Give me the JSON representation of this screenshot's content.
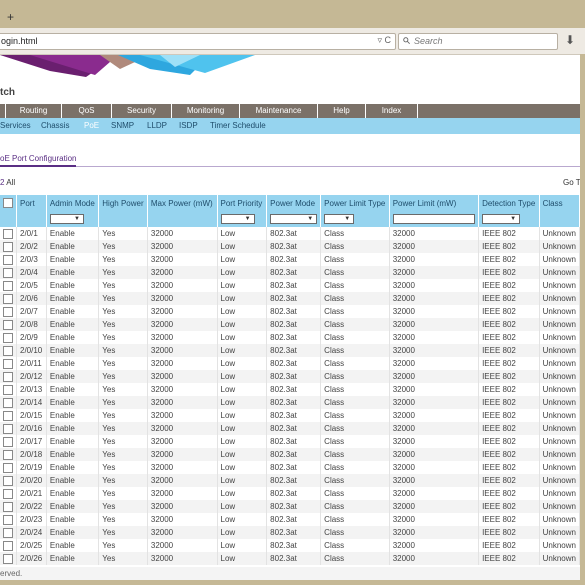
{
  "browser": {
    "newtab_symbol": "+",
    "url": "ogin.html",
    "url_icons": "▿ C",
    "search_placeholder": "Search",
    "download_symbol": "⬇"
  },
  "brand": {
    "title": "tch"
  },
  "menu": [
    {
      "label": ""
    },
    {
      "label": "Routing"
    },
    {
      "label": "QoS"
    },
    {
      "label": "Security"
    },
    {
      "label": "Monitoring"
    },
    {
      "label": "Maintenance"
    },
    {
      "label": "Help"
    },
    {
      "label": "Index"
    }
  ],
  "submenu": [
    {
      "label": "Services"
    },
    {
      "label": "Chassis"
    },
    {
      "label": "PoE",
      "active": true
    },
    {
      "label": "SNMP"
    },
    {
      "label": "LLDP"
    },
    {
      "label": "ISDP"
    },
    {
      "label": "Timer Schedule"
    }
  ],
  "page": {
    "title": "oE Port Configuration",
    "count": "2",
    "count_label": "All",
    "goto": "Go To"
  },
  "table": {
    "columns": [
      "",
      "Port",
      "Admin Mode",
      "High Power",
      "Max Power (mW)",
      "Port Priority",
      "Power Mode",
      "Power Limit Type",
      "Power Limit (mW)",
      "Detection Type",
      "Class"
    ],
    "rows": [
      [
        "2/0/1",
        "Enable",
        "Yes",
        "32000",
        "Low",
        "802.3at",
        "Class",
        "32000",
        "IEEE 802",
        "Unknown"
      ],
      [
        "2/0/2",
        "Enable",
        "Yes",
        "32000",
        "Low",
        "802.3at",
        "Class",
        "32000",
        "IEEE 802",
        "Unknown"
      ],
      [
        "2/0/3",
        "Enable",
        "Yes",
        "32000",
        "Low",
        "802.3at",
        "Class",
        "32000",
        "IEEE 802",
        "Unknown"
      ],
      [
        "2/0/4",
        "Enable",
        "Yes",
        "32000",
        "Low",
        "802.3at",
        "Class",
        "32000",
        "IEEE 802",
        "Unknown"
      ],
      [
        "2/0/5",
        "Enable",
        "Yes",
        "32000",
        "Low",
        "802.3at",
        "Class",
        "32000",
        "IEEE 802",
        "Unknown"
      ],
      [
        "2/0/6",
        "Enable",
        "Yes",
        "32000",
        "Low",
        "802.3at",
        "Class",
        "32000",
        "IEEE 802",
        "Unknown"
      ],
      [
        "2/0/7",
        "Enable",
        "Yes",
        "32000",
        "Low",
        "802.3at",
        "Class",
        "32000",
        "IEEE 802",
        "Unknown"
      ],
      [
        "2/0/8",
        "Enable",
        "Yes",
        "32000",
        "Low",
        "802.3at",
        "Class",
        "32000",
        "IEEE 802",
        "Unknown"
      ],
      [
        "2/0/9",
        "Enable",
        "Yes",
        "32000",
        "Low",
        "802.3at",
        "Class",
        "32000",
        "IEEE 802",
        "Unknown"
      ],
      [
        "2/0/10",
        "Enable",
        "Yes",
        "32000",
        "Low",
        "802.3at",
        "Class",
        "32000",
        "IEEE 802",
        "Unknown"
      ],
      [
        "2/0/11",
        "Enable",
        "Yes",
        "32000",
        "Low",
        "802.3at",
        "Class",
        "32000",
        "IEEE 802",
        "Unknown"
      ],
      [
        "2/0/12",
        "Enable",
        "Yes",
        "32000",
        "Low",
        "802.3at",
        "Class",
        "32000",
        "IEEE 802",
        "Unknown"
      ],
      [
        "2/0/13",
        "Enable",
        "Yes",
        "32000",
        "Low",
        "802.3at",
        "Class",
        "32000",
        "IEEE 802",
        "Unknown"
      ],
      [
        "2/0/14",
        "Enable",
        "Yes",
        "32000",
        "Low",
        "802.3at",
        "Class",
        "32000",
        "IEEE 802",
        "Unknown"
      ],
      [
        "2/0/15",
        "Enable",
        "Yes",
        "32000",
        "Low",
        "802.3at",
        "Class",
        "32000",
        "IEEE 802",
        "Unknown"
      ],
      [
        "2/0/16",
        "Enable",
        "Yes",
        "32000",
        "Low",
        "802.3at",
        "Class",
        "32000",
        "IEEE 802",
        "Unknown"
      ],
      [
        "2/0/17",
        "Enable",
        "Yes",
        "32000",
        "Low",
        "802.3at",
        "Class",
        "32000",
        "IEEE 802",
        "Unknown"
      ],
      [
        "2/0/18",
        "Enable",
        "Yes",
        "32000",
        "Low",
        "802.3at",
        "Class",
        "32000",
        "IEEE 802",
        "Unknown"
      ],
      [
        "2/0/19",
        "Enable",
        "Yes",
        "32000",
        "Low",
        "802.3at",
        "Class",
        "32000",
        "IEEE 802",
        "Unknown"
      ],
      [
        "2/0/20",
        "Enable",
        "Yes",
        "32000",
        "Low",
        "802.3at",
        "Class",
        "32000",
        "IEEE 802",
        "Unknown"
      ],
      [
        "2/0/21",
        "Enable",
        "Yes",
        "32000",
        "Low",
        "802.3at",
        "Class",
        "32000",
        "IEEE 802",
        "Unknown"
      ],
      [
        "2/0/22",
        "Enable",
        "Yes",
        "32000",
        "Low",
        "802.3at",
        "Class",
        "32000",
        "IEEE 802",
        "Unknown"
      ],
      [
        "2/0/23",
        "Enable",
        "Yes",
        "32000",
        "Low",
        "802.3at",
        "Class",
        "32000",
        "IEEE 802",
        "Unknown"
      ],
      [
        "2/0/24",
        "Enable",
        "Yes",
        "32000",
        "Low",
        "802.3at",
        "Class",
        "32000",
        "IEEE 802",
        "Unknown"
      ],
      [
        "2/0/25",
        "Enable",
        "Yes",
        "32000",
        "Low",
        "802.3at",
        "Class",
        "32000",
        "IEEE 802",
        "Unknown"
      ],
      [
        "2/0/26",
        "Enable",
        "Yes",
        "32000",
        "Low",
        "802.3at",
        "Class",
        "32000",
        "IEEE 802",
        "Unknown"
      ]
    ]
  },
  "footer": {
    "text": "erved."
  },
  "colors": {
    "menu_bg": "#7b7168",
    "submenu_bg": "#96d4ef",
    "accent": "#5a2e84",
    "browser_frame": "#c5b895"
  }
}
